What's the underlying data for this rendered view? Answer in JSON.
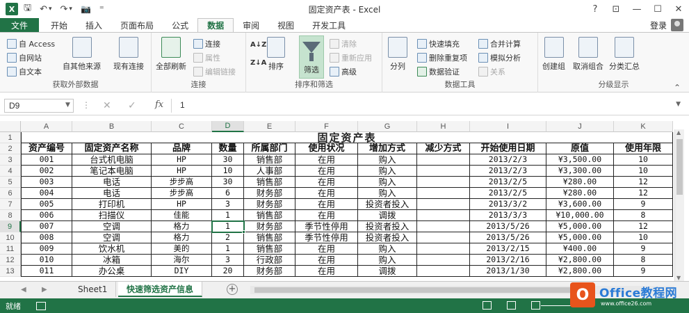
{
  "window": {
    "title": "固定资产表 - Excel",
    "app_logo": "X",
    "controls": {
      "help": "?",
      "ribbon_display": "⊡",
      "minimize": "—",
      "restore": "☐",
      "close": "✕"
    }
  },
  "qat": {
    "save": "🖫",
    "undo": "↶",
    "undo_dd": "▾",
    "redo": "↷",
    "redo_dd": "▾",
    "camera": "📷",
    "customize": "⁼"
  },
  "tabs": [
    {
      "label": "文件"
    },
    {
      "label": "开始"
    },
    {
      "label": "插入"
    },
    {
      "label": "页面布局"
    },
    {
      "label": "公式"
    },
    {
      "label": "数据"
    },
    {
      "label": "审阅"
    },
    {
      "label": "视图"
    },
    {
      "label": "开发工具"
    }
  ],
  "login": "登录",
  "ribbon": {
    "ext": {
      "access": "自 Access",
      "web": "自网站",
      "text": "自文本",
      "other": "自其他来源",
      "existing": "现有连接",
      "label": "获取外部数据"
    },
    "conn": {
      "refresh": "全部刷新",
      "connections": "连接",
      "properties": "属性",
      "edit_links": "编辑链接",
      "label": "连接"
    },
    "sort": {
      "sort": "排序",
      "filter": "筛选",
      "clear": "清除",
      "reapply": "重新应用",
      "advanced": "高级",
      "label": "排序和筛选",
      "az": "A↓Z",
      "za": "Z↓A"
    },
    "tools": {
      "split": "分列",
      "flash_fill": "快速填充",
      "remove_dup": "删除重复项",
      "validation": "数据验证",
      "consolidate": "合并计算",
      "what_if": "模拟分析",
      "relations": "关系",
      "label": "数据工具"
    },
    "outline": {
      "group": "创建组",
      "ungroup": "取消组合",
      "subtotal": "分类汇总",
      "label": "分级显示"
    }
  },
  "formula_bar": {
    "name_box": "D9",
    "value": "1",
    "fx": "fx",
    "cancel": "✕",
    "enter": "✓"
  },
  "columns": [
    "A",
    "B",
    "C",
    "D",
    "E",
    "F",
    "G",
    "H",
    "I",
    "J",
    "K"
  ],
  "rows": [
    "1",
    "2",
    "3",
    "4",
    "5",
    "6",
    "7",
    "8",
    "9",
    "10",
    "11",
    "12",
    "13"
  ],
  "sheet": {
    "title": "固定资产表",
    "headers": [
      "资产编号",
      "固定资产名称",
      "品牌",
      "数量",
      "所属部门",
      "使用状况",
      "增加方式",
      "减少方式",
      "开始使用日期",
      "原值",
      "使用年限"
    ],
    "data": [
      [
        "001",
        "台式机电脑",
        "HP",
        "30",
        "销售部",
        "在用",
        "购入",
        "",
        "2013/2/3",
        "¥3,500.00",
        "10"
      ],
      [
        "002",
        "笔记本电脑",
        "HP",
        "10",
        "人事部",
        "在用",
        "购入",
        "",
        "2013/2/3",
        "¥3,300.00",
        "10"
      ],
      [
        "003",
        "电话",
        "步步高",
        "30",
        "销售部",
        "在用",
        "购入",
        "",
        "2013/2/5",
        "¥280.00",
        "12"
      ],
      [
        "004",
        "电话",
        "步步高",
        "6",
        "财务部",
        "在用",
        "购入",
        "",
        "2013/2/5",
        "¥280.00",
        "12"
      ],
      [
        "005",
        "打印机",
        "HP",
        "3",
        "财务部",
        "在用",
        "投资者投入",
        "",
        "2013/3/2",
        "¥3,600.00",
        "9"
      ],
      [
        "006",
        "扫描仪",
        "佳能",
        "1",
        "销售部",
        "在用",
        "调拨",
        "",
        "2013/3/3",
        "¥10,000.00",
        "8"
      ],
      [
        "007",
        "空调",
        "格力",
        "1",
        "财务部",
        "季节性停用",
        "投资者投入",
        "",
        "2013/5/26",
        "¥5,000.00",
        "12"
      ],
      [
        "008",
        "空调",
        "格力",
        "2",
        "销售部",
        "季节性停用",
        "投资者投入",
        "",
        "2013/5/26",
        "¥5,000.00",
        "10"
      ],
      [
        "009",
        "饮水机",
        "美的",
        "1",
        "销售部",
        "在用",
        "购入",
        "",
        "2013/2/15",
        "¥400.00",
        "9"
      ],
      [
        "010",
        "冰箱",
        "海尔",
        "3",
        "行政部",
        "在用",
        "购入",
        "",
        "2013/2/16",
        "¥2,800.00",
        "8"
      ],
      [
        "011",
        "办公桌",
        "DIY",
        "20",
        "财务部",
        "在用",
        "调拨",
        "",
        "2013/1/30",
        "¥2,800.00",
        "9"
      ]
    ]
  },
  "sheet_tabs": [
    {
      "label": "Sheet1"
    },
    {
      "label": "快速筛选资产信息"
    }
  ],
  "sheet_nav": {
    "prev": "◀",
    "next": "▶",
    "add": "+"
  },
  "status": {
    "ready": "就绪"
  },
  "watermark": {
    "main": "Office教程网",
    "url": "www.office26.com",
    "logo_glyph": "O"
  }
}
